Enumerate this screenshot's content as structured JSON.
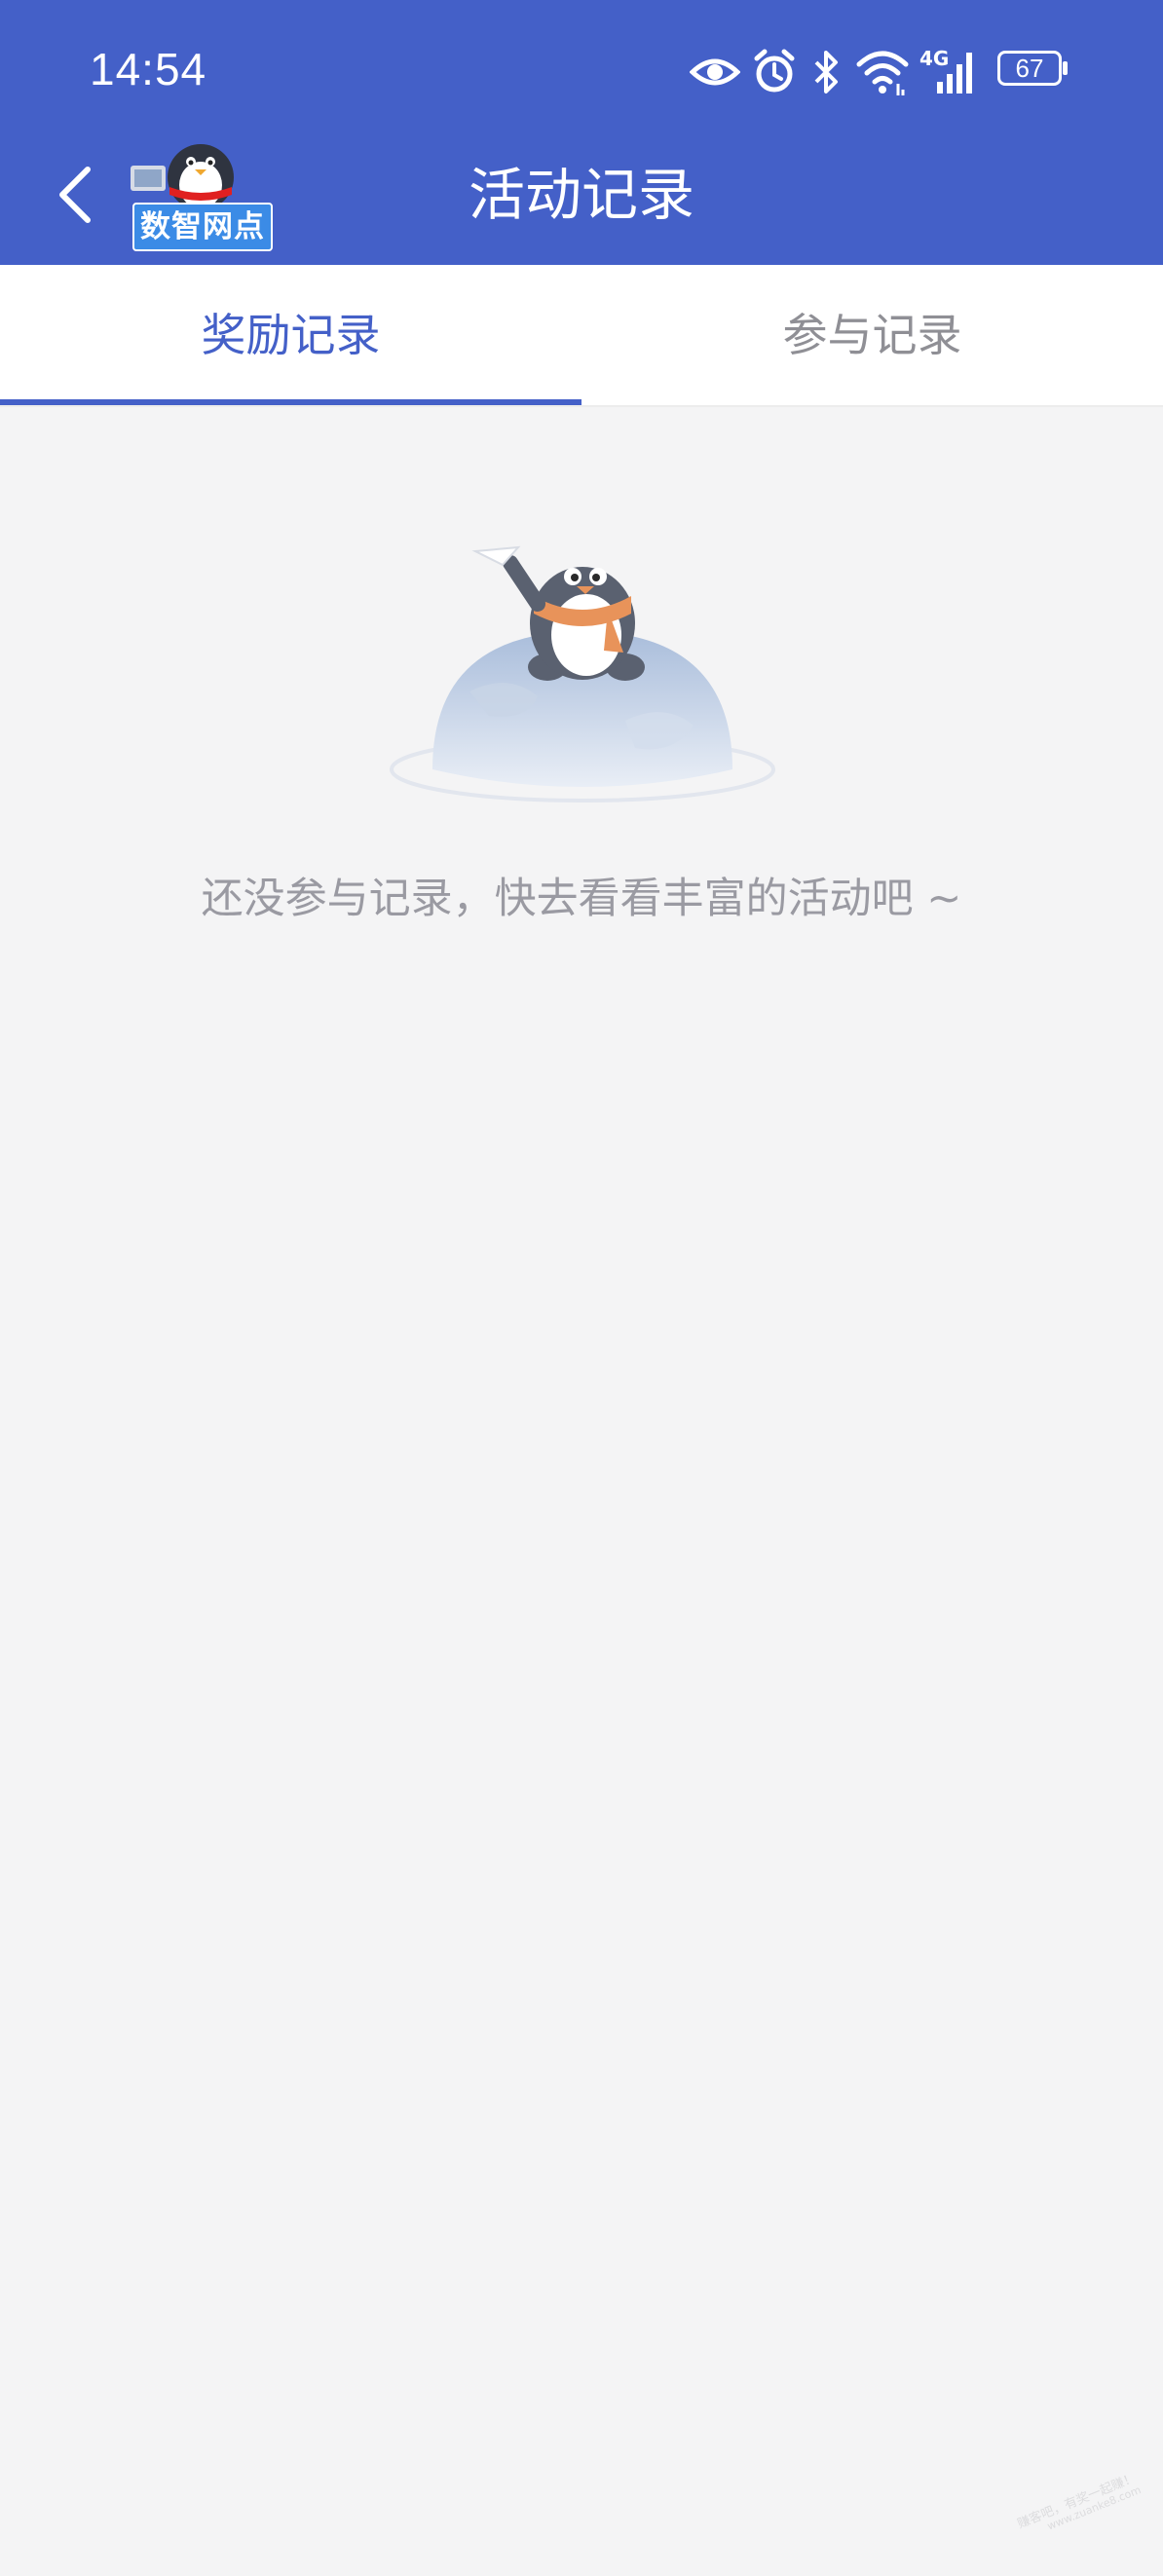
{
  "status_bar": {
    "time": "14:54",
    "network": "4G",
    "battery": "67",
    "icons": [
      "eye-icon",
      "alarm-icon",
      "bluetooth-icon",
      "wifi-icon",
      "signal-icon",
      "battery-icon"
    ]
  },
  "header": {
    "title": "活动记录",
    "logo_text": "数智网点",
    "back_icon": "chevron-left-icon",
    "background_color": "#4460c8"
  },
  "tabs": [
    {
      "label": "奖励记录",
      "active": true
    },
    {
      "label": "参与记录",
      "active": false
    }
  ],
  "empty_state": {
    "illustration": "penguin-on-globe",
    "message": "还没参与记录，快去看看丰富的活动吧 ~"
  },
  "watermark": {
    "line1": "赚客吧，有奖一起赚！",
    "line2": "www.zuanke8.com"
  },
  "colors": {
    "accent": "#4460c8",
    "page_background": "#f4f4f5",
    "inactive_tab_text": "#8f8f95",
    "empty_text": "#9a9aa2"
  }
}
